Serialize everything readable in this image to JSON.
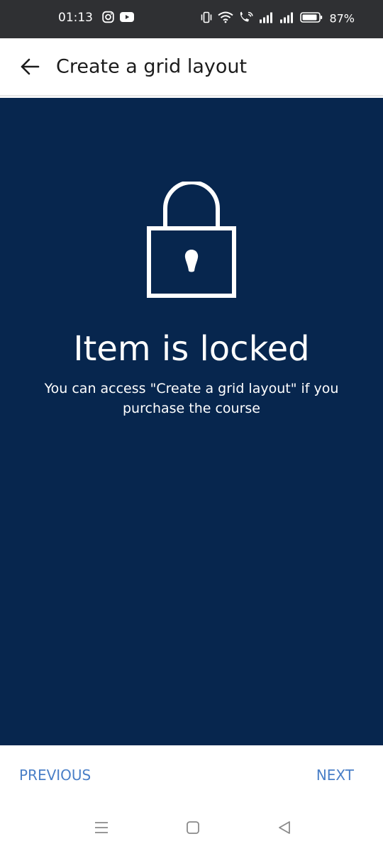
{
  "status_bar": {
    "time": "01:13",
    "battery_percent": "87%",
    "icons": [
      "instagram-icon",
      "youtube-icon",
      "vibrate-icon",
      "wifi-icon",
      "wifi-call-icon",
      "signal-icon",
      "signal-icon",
      "battery-icon"
    ]
  },
  "header": {
    "title": "Create a grid layout",
    "back_icon": "back-arrow-icon"
  },
  "locked": {
    "icon": "lock-icon",
    "heading": "Item is locked",
    "message": "You can access \"Create a grid layout\" if you purchase the course"
  },
  "navigation": {
    "previous_label": "PREVIOUS",
    "next_label": "NEXT"
  },
  "system_nav": {
    "icons": [
      "menu-icon",
      "home-icon",
      "back-icon"
    ]
  },
  "colors": {
    "status_bar_bg": "#2f3033",
    "panel_bg": "#07264e",
    "nav_link": "#4a7fc7",
    "title_text": "#1c1c1c"
  }
}
